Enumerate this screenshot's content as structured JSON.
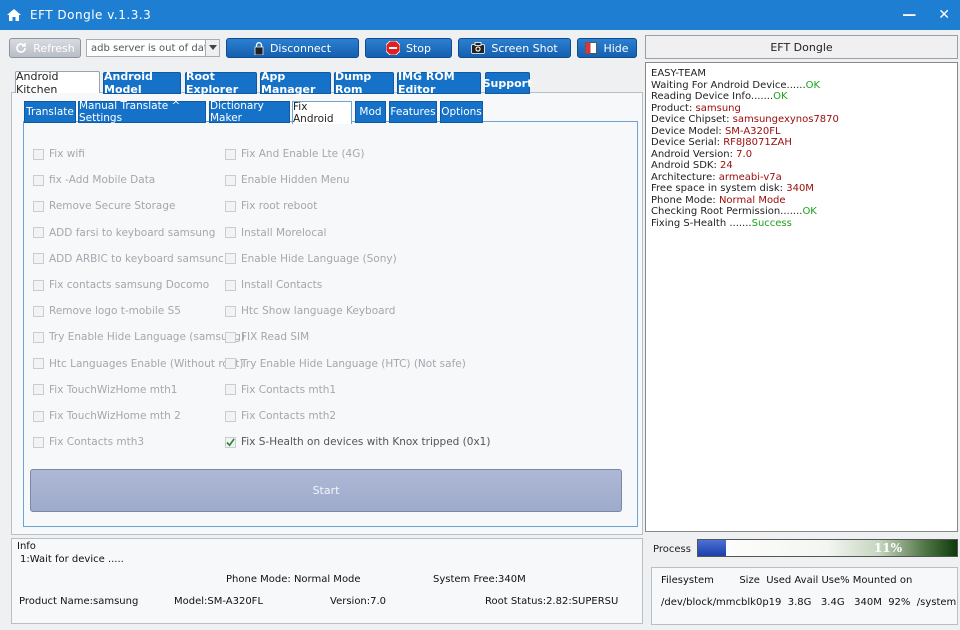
{
  "window": {
    "title": "EFT Dongle  v.1.3.3"
  },
  "toolbar": {
    "refresh": "Refresh",
    "server_combo": "adb server is out of date",
    "disconnect": "Disconnect",
    "stop": "Stop",
    "screenshot": "Screen Shot",
    "hide": "Hide"
  },
  "main_tabs": [
    "Android Kitchen",
    "Android Model",
    "Root Explorer",
    "App Manager",
    "Dump Rom",
    "IMG ROM Editor",
    "Support"
  ],
  "sub_tabs": [
    "Translate",
    "Manual Translate ^ Settings",
    "Dictionary Maker",
    "Fix Android",
    "Mod",
    "Features",
    "Options"
  ],
  "options_left": [
    "Fix wifi",
    "fix -Add Mobile Data",
    "Remove Secure Storage",
    "ADD farsi to keyboard samsung",
    "ADD ARBIC to keyboard samsunc",
    "Fix contacts samsung Docomo",
    "Remove logo t-mobile S5",
    "Try Enable Hide Language (samsung)",
    "Htc Languages Enable (Without root)",
    "Fix TouchWizHome mth1",
    "Fix TouchWizHome mth 2",
    "Fix Contacts  mth3"
  ],
  "options_right": [
    "Fix And Enable Lte (4G)",
    "Enable Hidden Menu",
    "Fix root reboot",
    "Install Morelocal",
    "Enable Hide  Language (Sony)",
    "Install Contacts",
    "Htc Show language  Keyboard",
    "FIX Read SIM",
    "Try Enable Hide  Language (HTC) (Not safe)",
    "Fix Contacts  mth1",
    "Fix Contacts  mth2",
    "Fix S-Health on devices with Knox tripped (0x1)"
  ],
  "start_label": "Start",
  "info": {
    "label": "Info",
    "status": "1:Wait for device .....",
    "phone_mode": "Phone Mode: Normal Mode",
    "system_free": "System Free:340M",
    "product": "Product Name:samsung",
    "model": "Model:SM-A320FL",
    "version": "Version:7.0",
    "root": "Root Status:2.82:SUPERSU"
  },
  "right": {
    "header": "EFT Dongle",
    "log": [
      {
        "text": "EASY-TEAM",
        "val": ""
      },
      {
        "text": "Waiting For Android Device......",
        "ok": "OK"
      },
      {
        "text": "Reading Device Info.......",
        "ok": "OK"
      },
      {
        "text": "Product: ",
        "val": "samsung"
      },
      {
        "text": "Device Chipset: ",
        "val": "samsungexynos7870"
      },
      {
        "text": "Device Model: ",
        "val": "SM-A320FL"
      },
      {
        "text": "Device Serial: ",
        "val": "RF8J8071ZAH"
      },
      {
        "text": "Android Version: ",
        "val": "7.0"
      },
      {
        "text": "Android SDK: ",
        "val": "24"
      },
      {
        "text": "Architecture: ",
        "val": "armeabi-v7a"
      },
      {
        "text": "Free space in system disk: ",
        "val": "340M"
      },
      {
        "text": "Phone Mode: ",
        "val": "Normal Mode"
      },
      {
        "text": "Checking Root Permission.......",
        "ok": "OK"
      },
      {
        "text": "Fixing S-Health .......",
        "ok": "Success"
      }
    ],
    "process_label": "Process",
    "process_pct_text": "11%",
    "process_value": 0.11,
    "fs_header": "Filesystem        Size  Used Avail Use% Mounted on",
    "fs_row": "/dev/block/mmcblk0p19  3.8G   3.4G   340M  92%  /system"
  },
  "colors": {
    "titlebar": "#1e7fd2",
    "tab_blue": "#1672c8",
    "ok_green": "#18a318",
    "value_red": "#9b0a0a"
  }
}
